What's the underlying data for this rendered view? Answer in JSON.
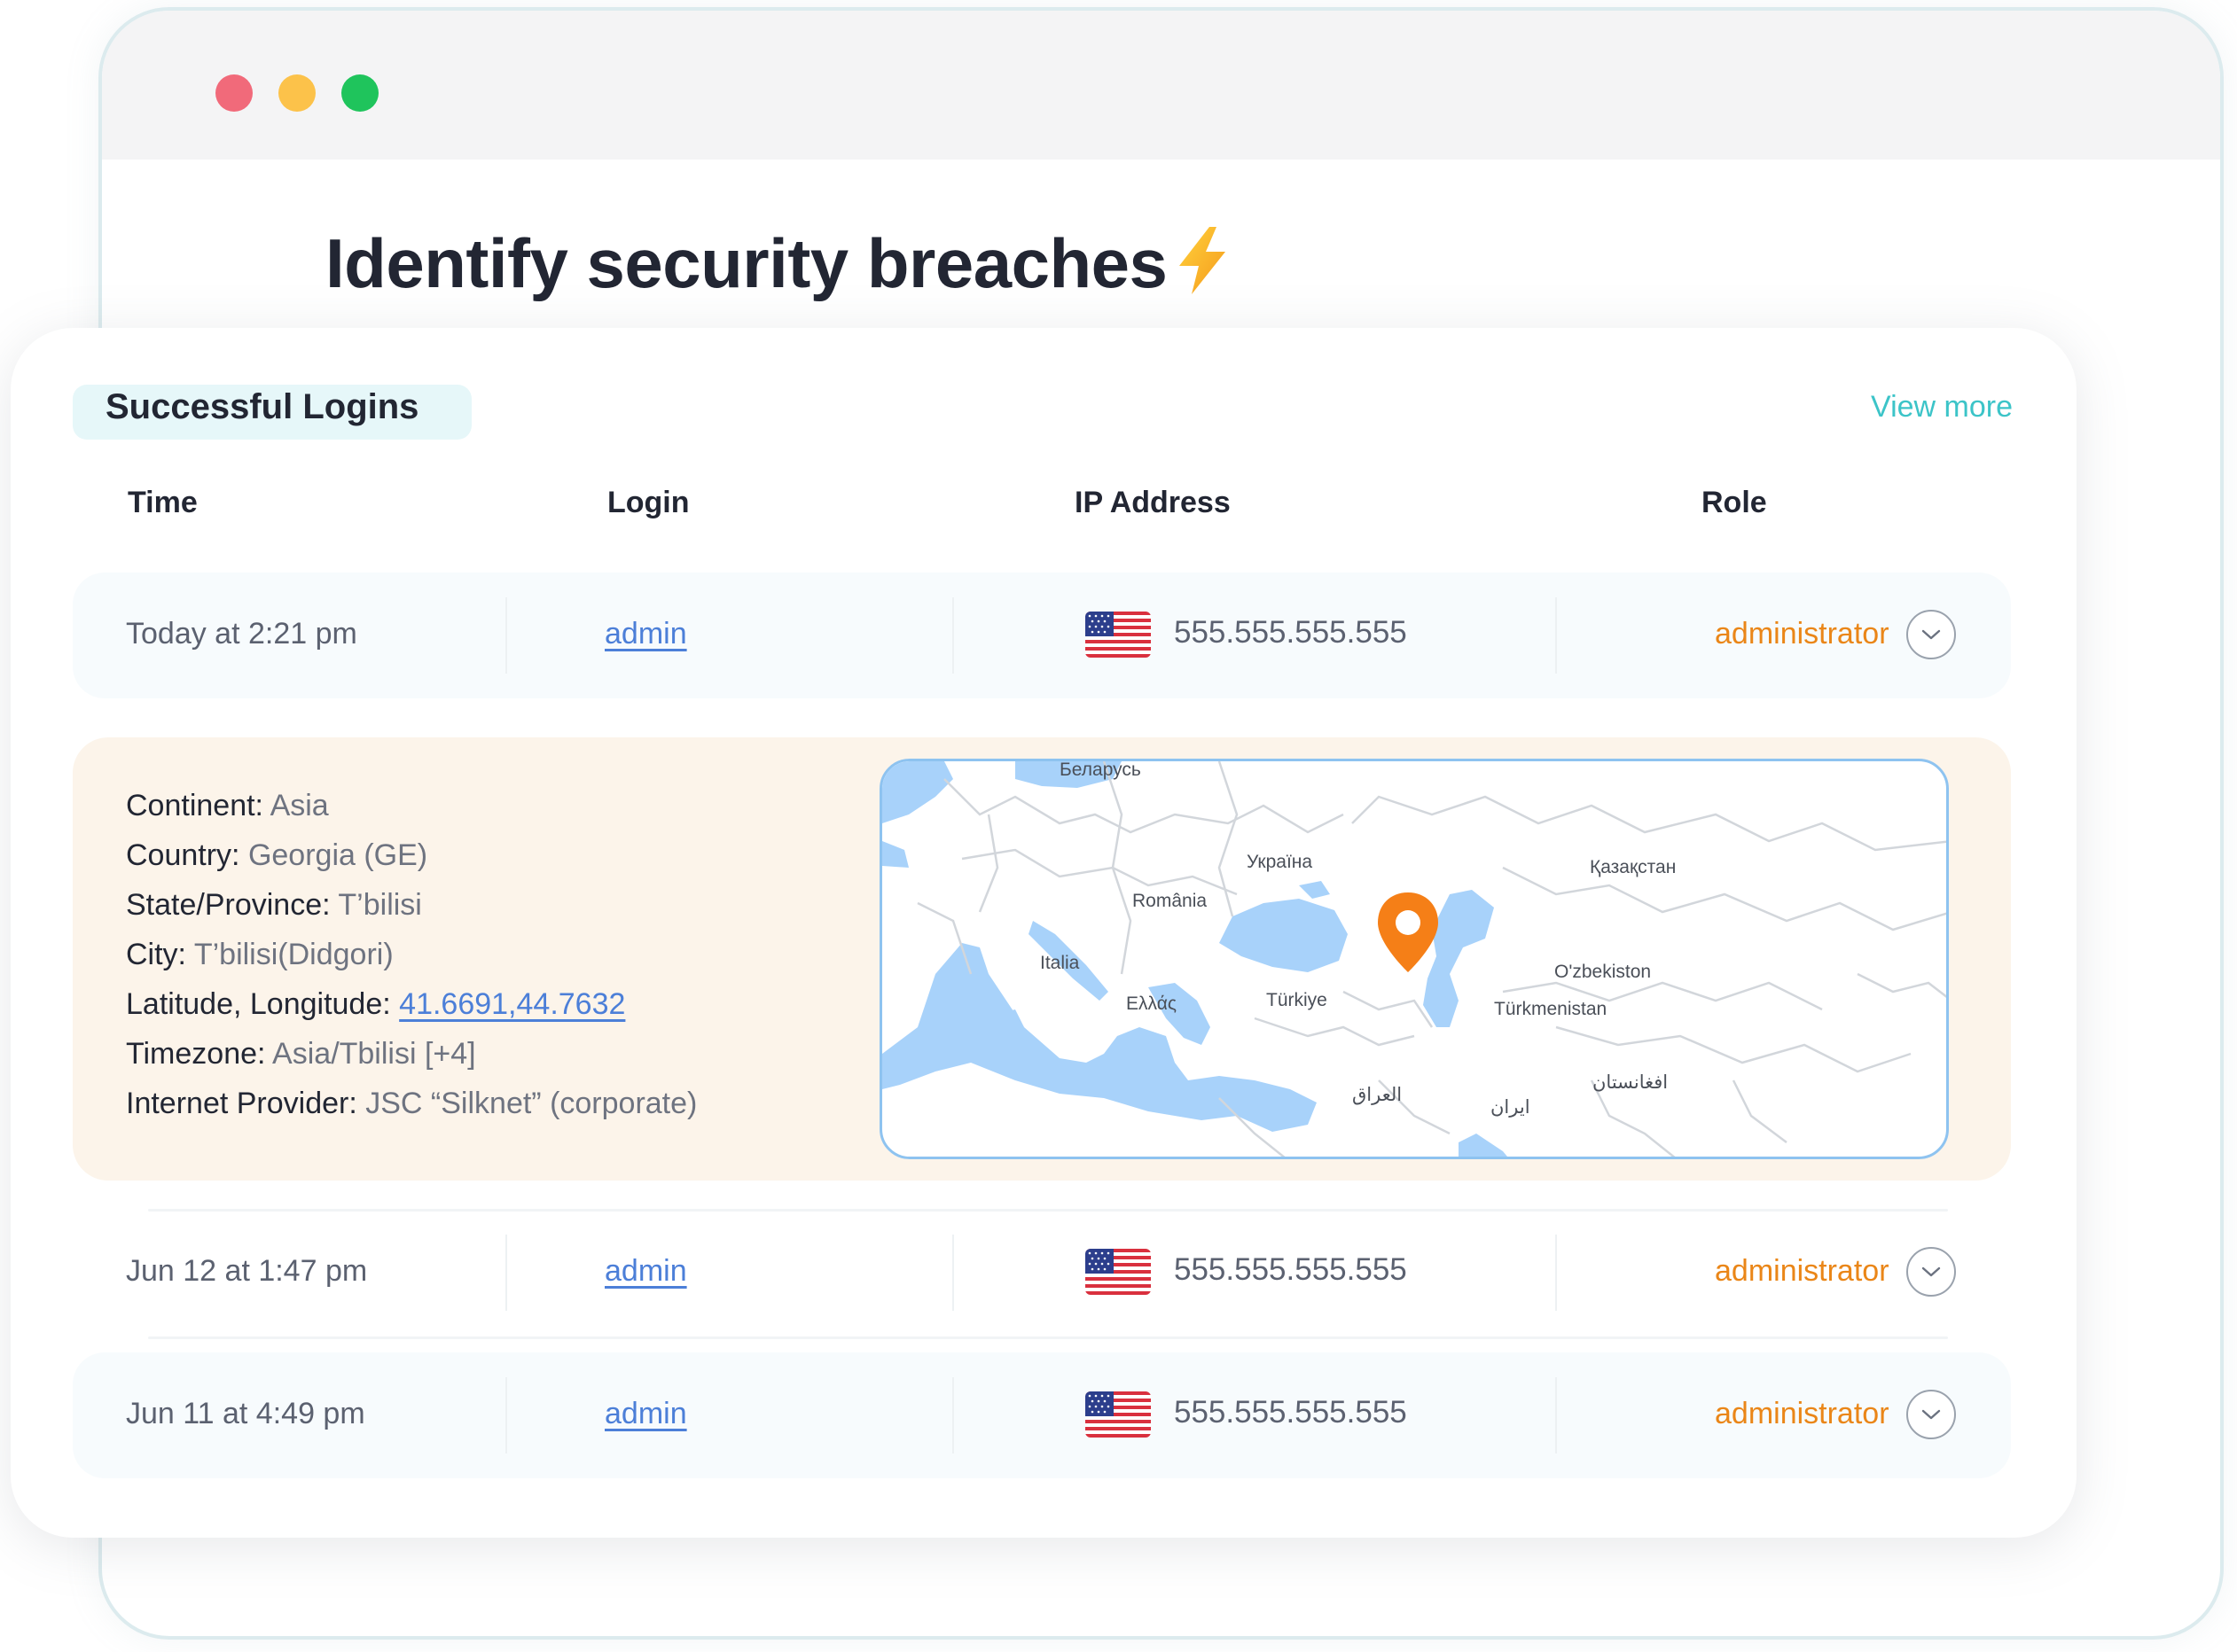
{
  "page": {
    "title": "Identify security breaches",
    "title_icon": "lightning-bolt-icon"
  },
  "colors": {
    "accent_teal": "#3cc4c8",
    "role_orange": "#ea8618",
    "link_blue": "#4c7fd8",
    "map_water": "#a8d2fa",
    "map_pin": "#f57f17",
    "details_bg": "#fcf4ea"
  },
  "card": {
    "section_title": "Successful Logins",
    "view_more": "View more",
    "columns": [
      "Time",
      "Login",
      "IP Address",
      "Role"
    ]
  },
  "logins": [
    {
      "time": "Today at 2:21 pm",
      "login": "admin",
      "country_flag": "us-flag-icon",
      "ip": "555.555.555.555",
      "role": "administrator",
      "expanded": true
    },
    {
      "time": "Jun 12 at 1:47 pm",
      "login": "admin",
      "country_flag": "us-flag-icon",
      "ip": "555.555.555.555",
      "role": "administrator",
      "expanded": false
    },
    {
      "time": "Jun 11 at 4:49 pm",
      "login": "admin",
      "country_flag": "us-flag-icon",
      "ip": "555.555.555.555",
      "role": "administrator",
      "expanded": false
    }
  ],
  "details": {
    "continent": {
      "label": "Continent:",
      "value": "Asia"
    },
    "country": {
      "label": "Country:",
      "value": "Georgia (GE)"
    },
    "state": {
      "label": "State/Province:",
      "value": "T’bilisi"
    },
    "city": {
      "label": "City:",
      "value": "T’bilisi(Didgori)"
    },
    "latlon": {
      "label": "Latitude, Longitude:",
      "value": "41.6691,44.7632"
    },
    "timezone": {
      "label": "Timezone:",
      "value": "Asia/Tbilisi [+4]"
    },
    "provider": {
      "label": "Internet Provider:",
      "value": "JSC “Silknet” (corporate)"
    }
  },
  "map": {
    "pin_icon": "location-pin-icon",
    "labels": [
      "Беларусь",
      "Україна",
      "România",
      "Italia",
      "Ελλάς",
      "Türkiye",
      "Қазақстан",
      "O'zbekiston",
      "Türkmenistan",
      "العراق",
      "ایران",
      "افغانستان"
    ]
  }
}
